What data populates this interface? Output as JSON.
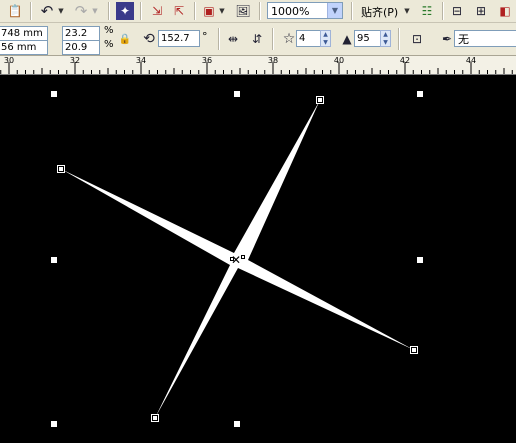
{
  "toolbar": {
    "zoom_value": "1000%",
    "snap_label": "贴齐(P)",
    "tooltips": {
      "paste": "paste-icon",
      "undo": "undo-icon",
      "redo": "redo-icon",
      "launcher": "application-launcher-icon",
      "import": "import-icon",
      "export": "export-icon",
      "publish": "publish-icon",
      "fullscreen": "fullscreen-icon",
      "options": "options-icon"
    }
  },
  "property_bar": {
    "width_value": "748 mm",
    "height_value": "56 mm",
    "scale_x": "23.2",
    "scale_y": "20.9",
    "percent_sign_1": "%",
    "percent_sign_2": "%",
    "rotation": "152.7",
    "degree_sign": "°",
    "points_value": "4",
    "sharpness_value": "95",
    "outline_value": "无"
  },
  "ruler": {
    "ticks": [
      "30",
      "32",
      "34",
      "36",
      "38",
      "40",
      "42",
      "44"
    ]
  }
}
